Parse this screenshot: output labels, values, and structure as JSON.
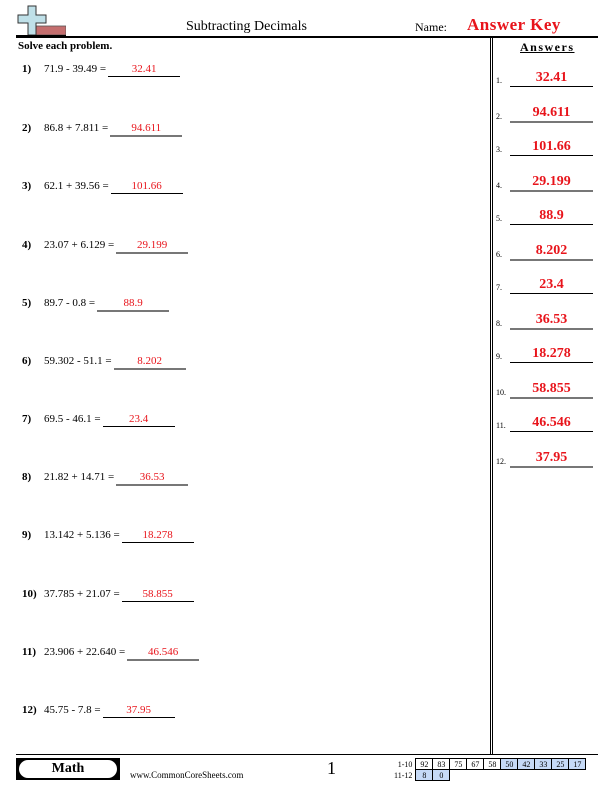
{
  "header": {
    "title": "Subtracting Decimals",
    "name_label": "Name:",
    "name_value": "Answer Key",
    "logo_icon": "plus-minus-logo"
  },
  "instructions": "Solve each problem.",
  "answers_title": "Answers",
  "problems": [
    {
      "num": "1)",
      "expr": "71.9 - 39.49 =",
      "answer": "32.41"
    },
    {
      "num": "2)",
      "expr": "86.8 + 7.811 =",
      "answer": "94.611"
    },
    {
      "num": "3)",
      "expr": "62.1 + 39.56 =",
      "answer": "101.66"
    },
    {
      "num": "4)",
      "expr": "23.07 + 6.129 =",
      "answer": "29.199"
    },
    {
      "num": "5)",
      "expr": "89.7 - 0.8 =",
      "answer": "88.9"
    },
    {
      "num": "6)",
      "expr": "59.302 - 51.1 =",
      "answer": "8.202"
    },
    {
      "num": "7)",
      "expr": "69.5 - 46.1 =",
      "answer": "23.4"
    },
    {
      "num": "8)",
      "expr": "21.82 + 14.71 =",
      "answer": "36.53"
    },
    {
      "num": "9)",
      "expr": "13.142 + 5.136 =",
      "answer": "18.278"
    },
    {
      "num": "10)",
      "expr": "37.785 + 21.07 =",
      "answer": "58.855"
    },
    {
      "num": "11)",
      "expr": "23.906 + 22.640 =",
      "answer": "46.546"
    },
    {
      "num": "12)",
      "expr": "45.75 - 7.8 =",
      "answer": "37.95"
    }
  ],
  "answer_key": [
    {
      "num": "1.",
      "value": "32.41"
    },
    {
      "num": "2.",
      "value": "94.611"
    },
    {
      "num": "3.",
      "value": "101.66"
    },
    {
      "num": "4.",
      "value": "29.199"
    },
    {
      "num": "5.",
      "value": "88.9"
    },
    {
      "num": "6.",
      "value": "8.202"
    },
    {
      "num": "7.",
      "value": "23.4"
    },
    {
      "num": "8.",
      "value": "36.53"
    },
    {
      "num": "9.",
      "value": "18.278"
    },
    {
      "num": "10.",
      "value": "58.855"
    },
    {
      "num": "11.",
      "value": "46.546"
    },
    {
      "num": "12.",
      "value": "37.95"
    }
  ],
  "footer": {
    "subject": "Math",
    "website": "www.CommonCoreSheets.com",
    "page": "1",
    "score_rows": [
      {
        "label": "1-10",
        "scores": [
          "92",
          "83",
          "75",
          "67",
          "58",
          "50",
          "42",
          "33",
          "25",
          "17"
        ],
        "highlight_from": 5
      },
      {
        "label": "11-12",
        "scores": [
          "8",
          "0"
        ],
        "highlight_from": 0
      }
    ]
  },
  "colors": {
    "answer_red": "#e8141b",
    "score_highlight": "#c6daf7"
  }
}
